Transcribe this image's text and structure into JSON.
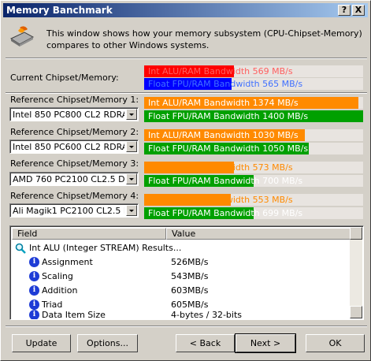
{
  "window": {
    "title": "Memory Banchmark"
  },
  "header": {
    "description": "This window shows how your memory subsystem (CPU-Chipset-Memory) compares to other Windows systems."
  },
  "colors": {
    "int_bar": "#ff0000",
    "float_bar": "#0000ff",
    "ref_int_bar": "#ff8a00",
    "ref_float_bar": "#00a000"
  },
  "current": {
    "label": "Current Chipset/Memory:",
    "int": {
      "text": "Int ALU/RAM Bandwidth 569 MB/s",
      "fraction": 0.41
    },
    "float": {
      "text": "Float FPU/RAM Bandwidth 565 MB/s",
      "fraction": 0.4
    }
  },
  "references": [
    {
      "label": "Reference Chipset/Memory 1:",
      "value": "Intel 850 PC800 CL2 RDRAM (R",
      "int": {
        "text": "Int ALU/RAM Bandwidth 1374 MB/s",
        "fraction": 0.98
      },
      "float": {
        "text": "Float FPU/RAM Bandwidth 1400 MB/s",
        "fraction": 1.0
      }
    },
    {
      "label": "Reference Chipset/Memory 2:",
      "value": "Intel 850 PC600 CL2 RDRAM (R",
      "int": {
        "text": "Int ALU/RAM Bandwidth 1030 MB/s",
        "fraction": 0.735
      },
      "float": {
        "text": "Float FPU/RAM Bandwidth 1050 MB/s",
        "fraction": 0.75
      }
    },
    {
      "label": "Reference Chipset/Memory 3:",
      "value": "AMD 760 PC2100 CL2.5 DDR (",
      "int": {
        "text": "Int ALU/RAM Bandwidth 573 MB/s",
        "fraction": 0.41
      },
      "float": {
        "text": "Float FPU/RAM Bandwidth 700 MB/s",
        "fraction": 0.5
      }
    },
    {
      "label": "Reference Chipset/Memory 4:",
      "value": "Ali Magik1 PC2100 CL2.5 DDR",
      "int": {
        "text": "Int ALU/RAM Bandwidth 553 MB/s",
        "fraction": 0.395
      },
      "float": {
        "text": "Float FPU/RAM Bandwidth 699 MB/s",
        "fraction": 0.5
      }
    }
  ],
  "results": {
    "columns": [
      "Field",
      "Value"
    ],
    "group": "Int ALU (Integer STREAM) Results...",
    "rows": [
      {
        "field": "Assignment",
        "value": "526MB/s"
      },
      {
        "field": "Scaling",
        "value": "543MB/s"
      },
      {
        "field": "Addition",
        "value": "603MB/s"
      },
      {
        "field": "Triad",
        "value": "605MB/s"
      },
      {
        "field": "Data Item Size",
        "value": "4-bytes / 32-bits"
      }
    ]
  },
  "buttons": {
    "update": "Update",
    "options": "Options...",
    "back": "< Back",
    "next": "Next >",
    "ok": "OK",
    "help": "?",
    "close": "X"
  }
}
